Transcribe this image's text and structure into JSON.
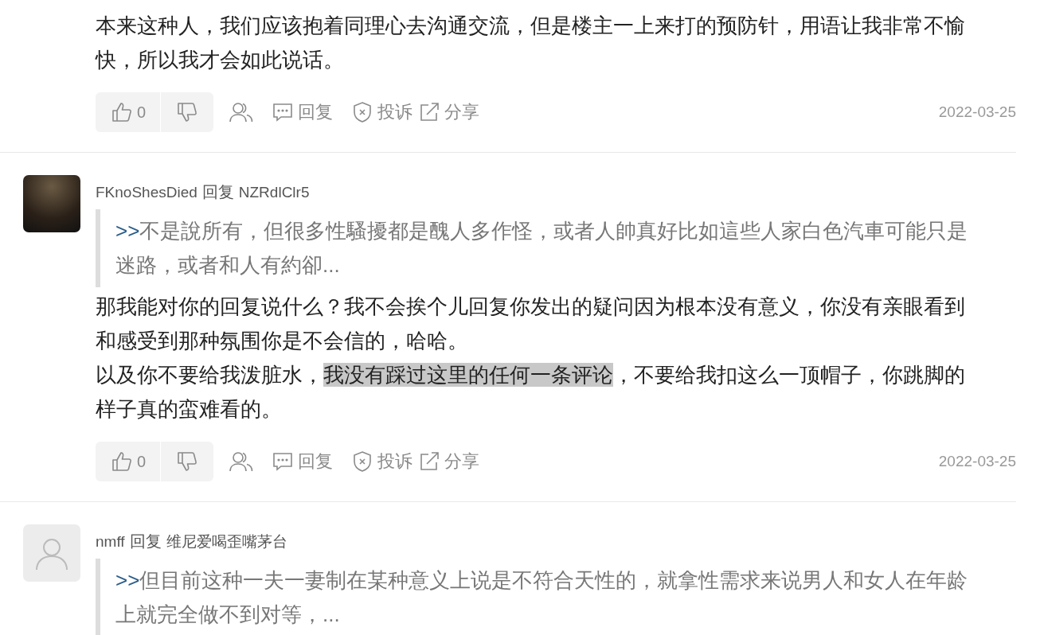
{
  "comments": [
    {
      "paragraphs": [
        {
          "segments": [
            {
              "text": "本来这种人，我们应该抱着同理心去沟通交流，但是楼主一上来打的预防针，用语让我非常不愉快，所以我才会如此说话。",
              "highlighted": false
            }
          ]
        }
      ],
      "actions": {
        "upvotes": "0",
        "reply": "回复",
        "report": "投诉",
        "share": "分享"
      },
      "date": "2022-03-25"
    },
    {
      "avatar": {
        "kind": "photo"
      },
      "author": "FKnoShesDied",
      "reply_word": "回复",
      "reply_to": "NZRdlClr5",
      "quote": {
        "prefix": ">>",
        "text": "不是說所有，但很多性騷擾都是醜人多作怪，或者人帥真好比如這些人家白色汽車可能只是迷路，或者和人有約卻..."
      },
      "paragraphs": [
        {
          "segments": [
            {
              "text": "那我能对你的回复说什么？我不会挨个儿回复你发出的疑问因为根本没有意义，你没有亲眼看到和感受到那种氛围你是不会信的，哈哈。",
              "highlighted": false
            }
          ]
        },
        {
          "segments": [
            {
              "text": "以及你不要给我泼脏水，",
              "highlighted": false
            },
            {
              "text": "我没有踩过这里的任何一条评论",
              "highlighted": true
            },
            {
              "text": "，不要给我扣这么一顶帽子，你跳脚的样子真的蛮难看的。",
              "highlighted": false
            }
          ]
        }
      ],
      "actions": {
        "upvotes": "0",
        "reply": "回复",
        "report": "投诉",
        "share": "分享"
      },
      "date": "2022-03-25"
    },
    {
      "avatar": {
        "kind": "default"
      },
      "author": "nmff",
      "reply_word": "回复",
      "reply_to": "维尼爱喝歪嘴茅台",
      "quote": {
        "prefix": ">>",
        "text": "但目前这种一夫一妻制在某种意义上说是不符合天性的，就拿性需求来说男人和女人在年龄上就完全做不到对等，..."
      }
    }
  ]
}
